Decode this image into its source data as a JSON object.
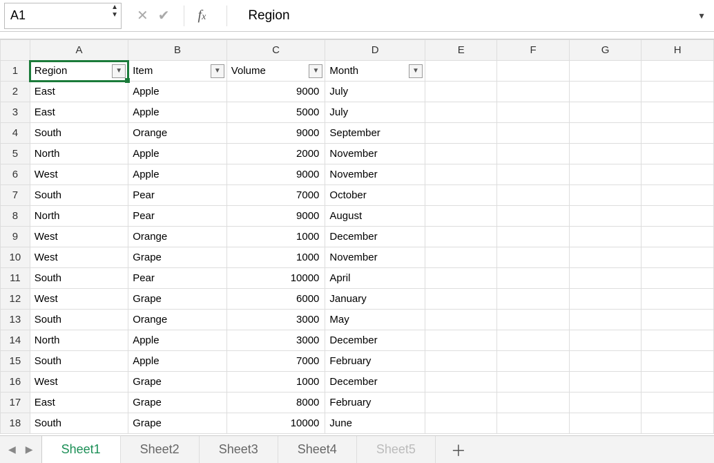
{
  "name_box": "A1",
  "formula_value": "Region",
  "columns": [
    "A",
    "B",
    "C",
    "D",
    "E",
    "F",
    "G",
    "H"
  ],
  "headers": [
    "Region",
    "Item",
    "Volume",
    "Month"
  ],
  "rows": [
    {
      "region": "East",
      "item": "Apple",
      "volume": "9000",
      "month": "July"
    },
    {
      "region": "East",
      "item": "Apple",
      "volume": "5000",
      "month": "July"
    },
    {
      "region": "South",
      "item": "Orange",
      "volume": "9000",
      "month": "September"
    },
    {
      "region": "North",
      "item": "Apple",
      "volume": "2000",
      "month": "November"
    },
    {
      "region": "West",
      "item": "Apple",
      "volume": "9000",
      "month": "November"
    },
    {
      "region": "South",
      "item": "Pear",
      "volume": "7000",
      "month": "October"
    },
    {
      "region": "North",
      "item": "Pear",
      "volume": "9000",
      "month": "August"
    },
    {
      "region": "West",
      "item": "Orange",
      "volume": "1000",
      "month": "December"
    },
    {
      "region": "West",
      "item": "Grape",
      "volume": "1000",
      "month": "November"
    },
    {
      "region": "South",
      "item": "Pear",
      "volume": "10000",
      "month": "April"
    },
    {
      "region": "West",
      "item": "Grape",
      "volume": "6000",
      "month": "January"
    },
    {
      "region": "South",
      "item": "Orange",
      "volume": "3000",
      "month": "May"
    },
    {
      "region": "North",
      "item": "Apple",
      "volume": "3000",
      "month": "December"
    },
    {
      "region": "South",
      "item": "Apple",
      "volume": "7000",
      "month": "February"
    },
    {
      "region": "West",
      "item": "Grape",
      "volume": "1000",
      "month": "December"
    },
    {
      "region": "East",
      "item": "Grape",
      "volume": "8000",
      "month": "February"
    },
    {
      "region": "South",
      "item": "Grape",
      "volume": "10000",
      "month": "June"
    }
  ],
  "sheets": [
    {
      "name": "Sheet1",
      "active": true
    },
    {
      "name": "Sheet2",
      "active": false
    },
    {
      "name": "Sheet3",
      "active": false
    },
    {
      "name": "Sheet4",
      "active": false
    },
    {
      "name": "Sheet5",
      "active": false,
      "disabled": true
    }
  ]
}
